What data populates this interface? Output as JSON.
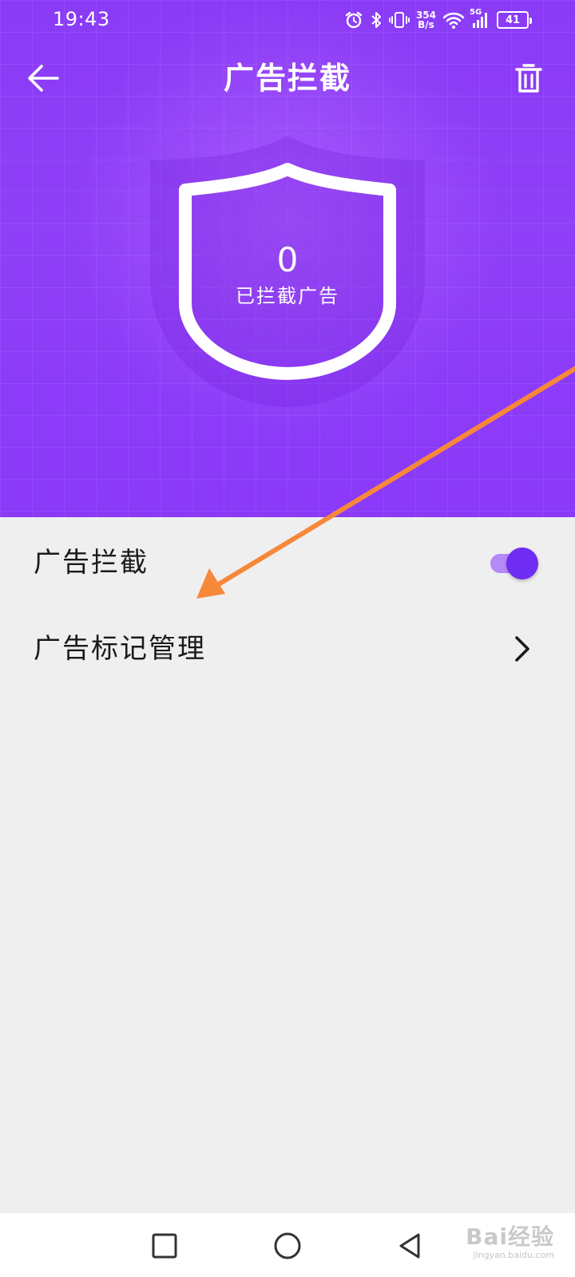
{
  "status_bar": {
    "time": "19:43",
    "net_speed_value": "354",
    "net_speed_unit": "B/s",
    "network_type": "5G",
    "battery_level": "41",
    "icons": [
      "alarm-icon",
      "bluetooth-icon",
      "vibrate-icon",
      "wifi-icon",
      "cellular-signal-icon",
      "battery-icon"
    ]
  },
  "app_bar": {
    "title": "广告拦截",
    "back_icon": "arrow-left-icon",
    "trash_icon": "trash-icon"
  },
  "hero": {
    "blocked_count": "0",
    "blocked_label": "已拦截广告",
    "shield_icon": "shield-icon"
  },
  "settings": {
    "items": [
      {
        "label": "广告拦截",
        "control": "toggle",
        "enabled": true
      },
      {
        "label": "广告标记管理",
        "control": "chevron-right-icon"
      }
    ]
  },
  "nav_bar": {
    "icons": [
      "square-recent-icon",
      "circle-home-icon",
      "triangle-back-icon"
    ]
  },
  "watermark": {
    "main": "Bai经验",
    "sub": "jingyan.baidu.com"
  },
  "colors": {
    "header_purple": "#8a3bf6",
    "toggle_knob": "#6f2cf2",
    "toggle_track": "#b58af6",
    "annotation_arrow": "#f7883a",
    "page_background": "#efefef"
  }
}
